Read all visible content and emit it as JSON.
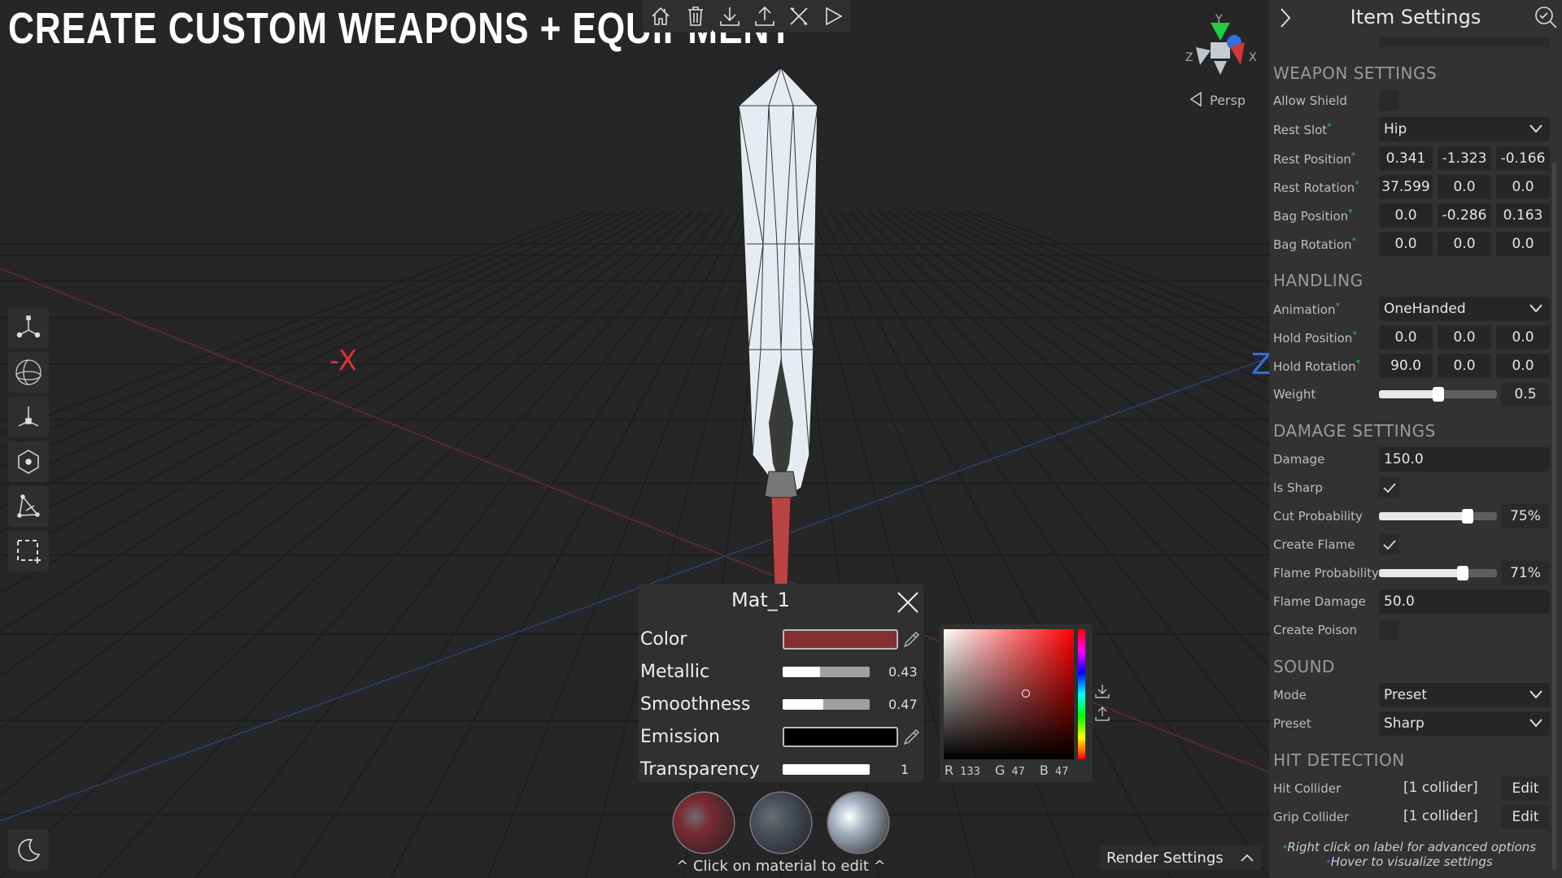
{
  "title": "CREATE CUSTOM WEAPONS + EQUIPMENT",
  "toolbar": {
    "items": [
      {
        "icon": "home-icon"
      },
      {
        "icon": "trash-icon"
      },
      {
        "icon": "download-icon"
      },
      {
        "icon": "upload-icon"
      },
      {
        "icon": "tools-icon"
      },
      {
        "icon": "play-icon"
      }
    ]
  },
  "viewport": {
    "axis_neg_x": "-X",
    "axis_z": "Z",
    "gizmo": {
      "y": "Y",
      "x": "X",
      "z": "Z"
    },
    "projection": "Persp",
    "colors": {
      "x": "#e03030",
      "y": "#22cc44",
      "z": "#3070e0"
    }
  },
  "left_tools": [
    "move-handle-icon",
    "rotate-sphere-icon",
    "transform-axes-icon",
    "hexagon-pivot-icon",
    "vertex-select-icon",
    "box-select-icon"
  ],
  "theme_icon": "moon-icon",
  "panel": {
    "title": "Item Settings",
    "sections": {
      "weapon": "WEAPON SETTINGS",
      "handling": "HANDLING",
      "damage": "DAMAGE SETTINGS",
      "sound": "SOUND",
      "hit": "HIT DETECTION"
    },
    "allow_shield": {
      "label": "Allow Shield",
      "checked": false
    },
    "rest_slot": {
      "label": "Rest Slot",
      "value": "Hip"
    },
    "rest_position": {
      "label": "Rest Position",
      "values": [
        "0.341",
        "-1.323",
        "-0.166"
      ]
    },
    "rest_rotation": {
      "label": "Rest Rotation",
      "values": [
        "37.599",
        "0.0",
        "0.0"
      ]
    },
    "bag_position": {
      "label": "Bag Position",
      "values": [
        "0.0",
        "-0.286",
        "0.163"
      ]
    },
    "bag_rotation": {
      "label": "Bag Rotation",
      "values": [
        "0.0",
        "0.0",
        "0.0"
      ]
    },
    "animation": {
      "label": "Animation",
      "value": "OneHanded"
    },
    "hold_position": {
      "label": "Hold Position",
      "values": [
        "0.0",
        "0.0",
        "0.0"
      ]
    },
    "hold_rotation": {
      "label": "Hold Rotation",
      "values": [
        "90.0",
        "0.0",
        "0.0"
      ]
    },
    "weight": {
      "label": "Weight",
      "value": "0.5",
      "fraction": 0.5
    },
    "damage": {
      "label": "Damage",
      "value": "150.0"
    },
    "is_sharp": {
      "label": "Is Sharp",
      "checked": true
    },
    "cut_probability": {
      "label": "Cut Probability",
      "value": "75%",
      "fraction": 0.75
    },
    "create_flame": {
      "label": "Create Flame",
      "checked": true
    },
    "flame_probability": {
      "label": "Flame Probability",
      "value": "71%",
      "fraction": 0.71
    },
    "flame_damage": {
      "label": "Flame Damage",
      "value": "50.0"
    },
    "create_poison": {
      "label": "Create Poison",
      "checked": false
    },
    "mode": {
      "label": "Mode",
      "value": "Preset"
    },
    "preset": {
      "label": "Preset",
      "value": "Sharp"
    },
    "hit_collider": {
      "label": "Hit Collider",
      "value": "[1 collider]",
      "button": "Edit"
    },
    "grip_collider": {
      "label": "Grip Collider",
      "value": "[1 collider]",
      "button": "Edit"
    },
    "note1": "Right click on label for advanced options",
    "note2": "Hover to visualize settings",
    "note_colors": {
      "advanced": "#2ecc40",
      "visualize": "#3080ff"
    }
  },
  "material": {
    "name": "Mat_1",
    "color": {
      "label": "Color",
      "hex": "#852f2f"
    },
    "metallic": {
      "label": "Metallic",
      "value": "0.43",
      "fraction": 0.43
    },
    "smoothness": {
      "label": "Smoothness",
      "value": "0.47",
      "fraction": 0.47
    },
    "emission": {
      "label": "Emission",
      "hex": "#000000"
    },
    "transparency": {
      "label": "Transparency",
      "value": "1",
      "fraction": 1
    },
    "picker": {
      "r_label": "R",
      "r": "133",
      "g_label": "G",
      "g": "47",
      "b_label": "B",
      "b": "47"
    },
    "caption": "^ Click on material to edit ^",
    "spheres": [
      "#7a2a32",
      "#4a525c",
      "#a8b4c4"
    ]
  },
  "render_settings": "Render Settings"
}
